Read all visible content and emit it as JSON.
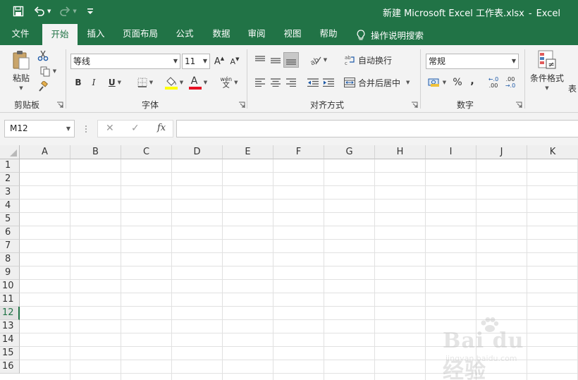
{
  "window": {
    "title": "新建 Microsoft Excel 工作表.xlsx",
    "separator": "-",
    "app_name": "Excel"
  },
  "tabs": [
    {
      "label": "文件",
      "active": false
    },
    {
      "label": "开始",
      "active": true
    },
    {
      "label": "插入",
      "active": false
    },
    {
      "label": "页面布局",
      "active": false
    },
    {
      "label": "公式",
      "active": false
    },
    {
      "label": "数据",
      "active": false
    },
    {
      "label": "审阅",
      "active": false
    },
    {
      "label": "视图",
      "active": false
    },
    {
      "label": "帮助",
      "active": false
    }
  ],
  "tell_me": {
    "label": "操作说明搜索",
    "icon": "lightbulb-icon"
  },
  "ribbon": {
    "clipboard": {
      "group_label": "剪贴板",
      "paste_label": "粘贴"
    },
    "font": {
      "group_label": "字体",
      "font_name": "等线",
      "font_size": "11",
      "bold": "B",
      "italic": "I",
      "underline": "U",
      "font_color_letter": "A",
      "phonetic_top": "wén",
      "phonetic_bottom": "文",
      "increase_font": "A",
      "decrease_font": "A"
    },
    "alignment": {
      "group_label": "对齐方式",
      "wrap_text_label": "自动换行",
      "merge_center_label": "合并后居中"
    },
    "number": {
      "group_label": "数字",
      "format": "常规",
      "percent": "%",
      "comma": ",",
      "inc_decimal": ".00",
      "dec_decimal": ".0"
    },
    "styles": {
      "conditional_format_label": "条件格式",
      "table_format_partial": "表"
    }
  },
  "formula_bar": {
    "name_box": "M12",
    "fx": "fx",
    "formula": ""
  },
  "grid": {
    "columns": [
      "A",
      "B",
      "C",
      "D",
      "E",
      "F",
      "G",
      "H",
      "I",
      "J",
      "K"
    ],
    "rows": [
      "1",
      "2",
      "3",
      "4",
      "5",
      "6",
      "7",
      "8",
      "9",
      "10",
      "11",
      "12",
      "13",
      "14",
      "15",
      "16"
    ],
    "active_row": "12"
  },
  "watermark": {
    "main": "Bai du 经验",
    "sub": "jingyan.baidu.com"
  },
  "colors": {
    "brand_green": "#217346",
    "ribbon_bg": "#f3f3f3",
    "header_bg": "#efefef",
    "font_color_bar": "#e81123",
    "highlight_bar": "#ffff00"
  }
}
